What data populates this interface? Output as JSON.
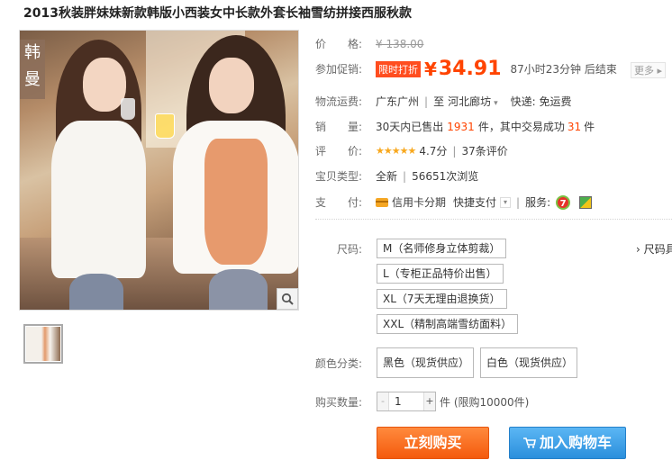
{
  "title": "2013秋装胖妹妹新款韩版小西装女中长款外套长袖雪纺拼接西服秋款",
  "gallery": {
    "brand_tag_line1": "韩",
    "brand_tag_line2": "曼"
  },
  "price_row": {
    "label": "价　　格:",
    "original_price": "¥ 138.00"
  },
  "promo_row": {
    "label": "参加促销:",
    "badge": "限时打折",
    "currency": "¥",
    "price": "34.91",
    "countdown": "87小时23分钟 后结束",
    "more": "更多 ▸"
  },
  "shipping_row": {
    "label": "物流运费:",
    "from": "广东广州",
    "to_prefix": "至",
    "to": "河北廊坊",
    "delivery": "快递: 免运费"
  },
  "sales_row": {
    "label": "销　　量:",
    "text_prefix": "30天内已售出",
    "sold": "1931",
    "text_mid": "件，其中交易成功",
    "success": "31",
    "text_suffix": "件"
  },
  "rating_row": {
    "label": "评　　价:",
    "stars": "★★★★★",
    "score": "4.7分",
    "reviews": "37条评价"
  },
  "type_row": {
    "label": "宝贝类型:",
    "condition": "全新",
    "views": "56651次浏览"
  },
  "pay_row": {
    "label": "支　　付:",
    "installment": "信用卡分期",
    "quick_pay": "快捷支付",
    "service_label": "服务:",
    "service_icon_text": "7"
  },
  "size": {
    "label": "尺码:",
    "options": [
      "M（名师修身立体剪裁）",
      "L（专柜正品特价出售）",
      "XL（7天无理由退换货）",
      "XXL（精制高端雪纺面料）"
    ],
    "guide": "› 尺码具"
  },
  "color": {
    "label": "颜色分类:",
    "options": [
      "黑色（现货供应）",
      "白色（现货供应）"
    ]
  },
  "quantity": {
    "label": "购买数量:",
    "minus": "-",
    "value": "1",
    "plus": "+",
    "unit": "件 (限购10000件)"
  },
  "buttons": {
    "buy_now": "立刻购买",
    "add_to_cart": "加入购物车"
  },
  "colors": {
    "accent": "#ff4400",
    "buy_button": "#f45a0d",
    "cart_button": "#2b8fdc",
    "star": "#f8a81e"
  }
}
